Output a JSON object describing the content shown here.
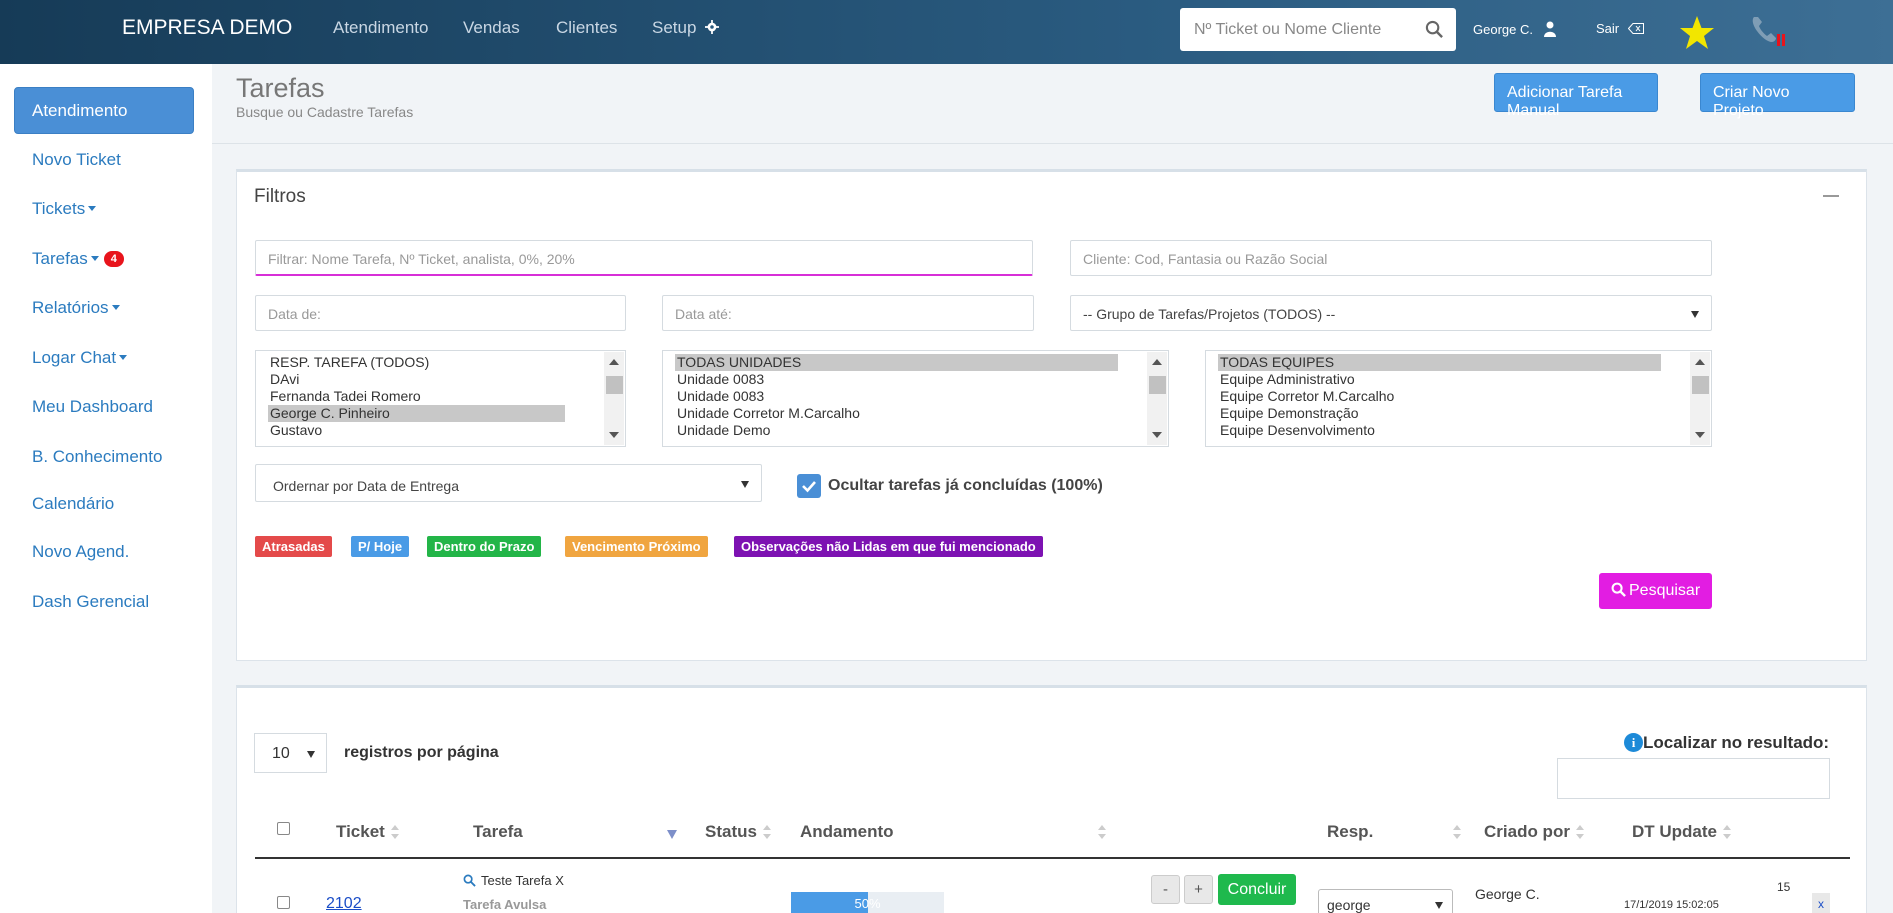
{
  "topnav": {
    "brand": "EMPRESA DEMO",
    "links": [
      "Atendimento",
      "Vendas",
      "Clientes",
      "Setup"
    ],
    "search_placeholder": "Nº Ticket ou Nome Cliente",
    "user_name": "George C.",
    "logout_label": "Sair",
    "star_color": "#f2e600"
  },
  "sidebar": {
    "active": "Atendimento",
    "items": [
      "Novo Ticket",
      "Tickets",
      "Tarefas",
      "Relatórios",
      "Logar Chat",
      "Meu Dashboard",
      "B. Conhecimento",
      "Calendário",
      "Novo Agend.",
      "Dash Gerencial"
    ],
    "tarefas_badge": "4"
  },
  "header": {
    "title": "Tarefas",
    "subtitle": "Busque ou Cadastre Tarefas",
    "add_manual_label": "Adicionar Tarefa Manual",
    "new_project_label": "Criar Novo Projeto"
  },
  "filters": {
    "title": "Filtros",
    "task_filter_placeholder": "Filtrar: Nome Tarefa, Nº Ticket, analista, 0%, 20%",
    "client_placeholder": "Cliente: Cod, Fantasia ou Razão Social",
    "date_from_placeholder": "Data de:",
    "date_to_placeholder": "Data até:",
    "group_select": "-- Grupo de Tarefas/Projetos (TODOS) --",
    "resp_options": [
      "RESP. TAREFA (TODOS)",
      "DAvi",
      "Fernanda Tadei Romero",
      "George C. Pinheiro",
      "Gustavo"
    ],
    "resp_selected": "George C. Pinheiro",
    "unit_options": [
      "TODAS UNIDADES",
      "Unidade 0083",
      "Unidade 0083",
      "Unidade Corretor M.Carcalho",
      "Unidade Demo"
    ],
    "unit_selected": "TODAS UNIDADES",
    "team_options": [
      "TODAS EQUIPES",
      "Equipe Administrativo",
      "Equipe Corretor M.Carcalho",
      "Equipe Demonstração",
      "Equipe Desenvolvimento"
    ],
    "team_selected": "TODAS EQUIPES",
    "order_select": "Ordernar por Data de Entrega",
    "hide_done_label": "Ocultar tarefas já concluídas (100%)",
    "hide_done_checked": true,
    "legend": [
      {
        "label": "Atrasadas",
        "color": "#e44a4a"
      },
      {
        "label": "P/ Hoje",
        "color": "#4a9be6"
      },
      {
        "label": "Dentro do Prazo",
        "color": "#23b548"
      },
      {
        "label": "Vencimento Próximo",
        "color": "#f0a540"
      },
      {
        "label": "Observações não Lidas em que fui mencionado",
        "color": "#7d12b2"
      }
    ],
    "search_button": "Pesquisar"
  },
  "results": {
    "per_page_value": "10",
    "per_page_label": "registros por página",
    "find_label": "Localizar no resultado:",
    "info_glyph": "i",
    "columns": [
      "Ticket",
      "Tarefa",
      "Status",
      "Andamento",
      "Resp.",
      "Criado por",
      "DT Update"
    ],
    "rows": [
      {
        "ticket": "2102",
        "task_name": "Teste Tarefa X",
        "task_type": "Tarefa Avulsa",
        "progress_label": "50%",
        "progress_fraction": 0.5,
        "minus_label": "-",
        "plus_label": "+",
        "conclude_label": "Concluir",
        "resp": "george",
        "created_by": "George C.",
        "dt_update": "17/1/2019 15:02:05",
        "extra_count": "15",
        "remove_label": "x"
      }
    ]
  }
}
